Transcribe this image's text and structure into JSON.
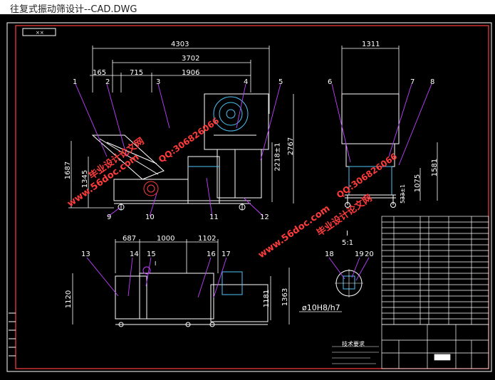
{
  "window": {
    "title": "往复式振动筛设计--CAD.DWG"
  },
  "drawing": {
    "frame_label": "××",
    "dimensions": {
      "front_overall": "4303",
      "front_span": "3702",
      "front_left": "165",
      "front_seg1": "715",
      "front_seg2": "1906",
      "front_height_left": "1687",
      "front_height_mid": "1345",
      "front_height_right": "2218±1",
      "front_height_total": "2767",
      "side_width": "1311",
      "side_height_1": "1581",
      "side_height_2": "1075",
      "side_height_3": "533±1",
      "plan_seg1": "687",
      "plan_seg2": "1000",
      "plan_seg3": "1102",
      "plan_height_left": "1120",
      "plan_height_r1": "1181",
      "plan_height_r2": "1363",
      "fit": "ø10H8/h7",
      "detail_label": "I",
      "detail_scale": "5:1",
      "plan_detail_mark": "I"
    },
    "balloons": [
      "1",
      "2",
      "3",
      "4",
      "5",
      "6",
      "7",
      "8",
      "9",
      "10",
      "11",
      "12",
      "13",
      "14",
      "15",
      "16",
      "17",
      "18",
      "19",
      "20"
    ],
    "watermarks": {
      "site": "www.56doc.com",
      "qq": "QQ:306826066",
      "brand": "毕业设计论文网"
    },
    "notes_title": "技术要求"
  }
}
